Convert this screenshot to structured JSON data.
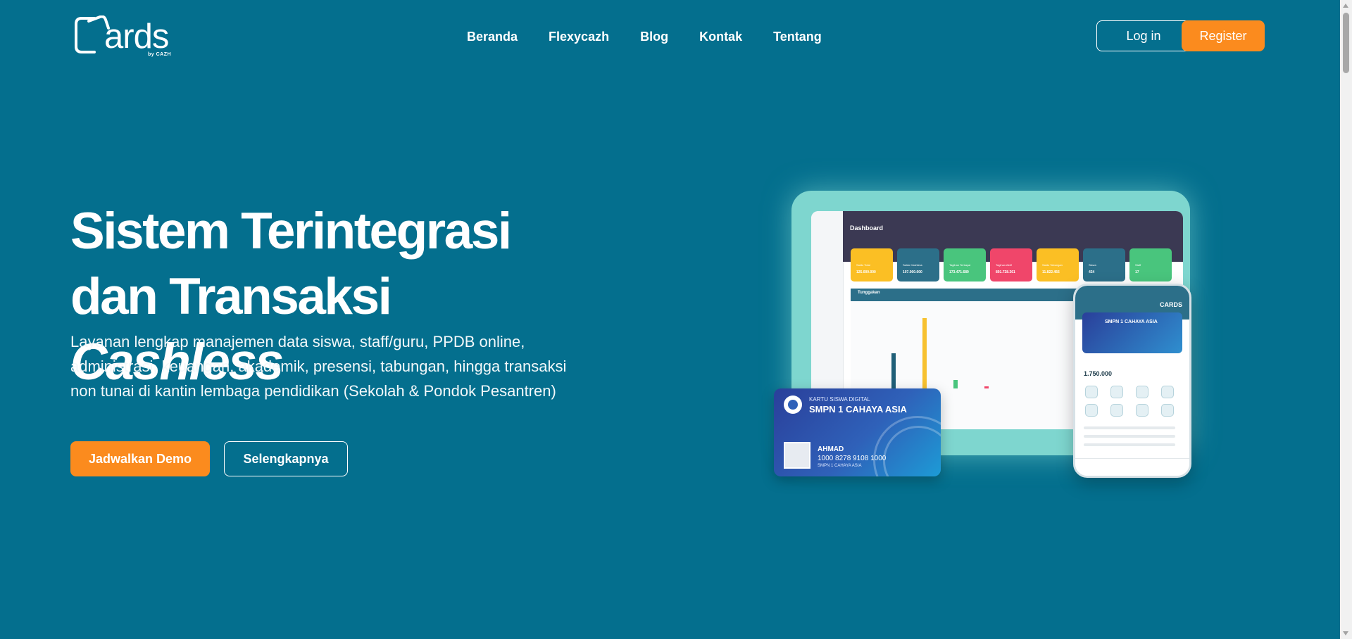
{
  "header": {
    "logo": {
      "word": "ards",
      "by": "by CAZH"
    },
    "nav": [
      "Beranda",
      "Flexycazh",
      "Blog",
      "Kontak",
      "Tentang"
    ],
    "login_label": "Log in",
    "register_label": "Register"
  },
  "hero": {
    "title_line1": "Sistem Terintegrasi",
    "title_line2_prefix": "dan Transaksi ",
    "title_line2_emphasis": "Cashless",
    "description": "Layanan lengkap manajemen data siswa, staff/guru, PPDB online, administrasi, keuangan, akademik, presensi, tabungan, hingga transaksi non tunai di kantin lembaga pendidikan (Sekolah & Pondok Pesantren)",
    "demo_label": "Jadwalkan Demo",
    "more_label": "Selengkapnya"
  },
  "illustration": {
    "dashboard_title": "Dashboard",
    "panel_title": "Tunggakan",
    "stat_cards": [
      {
        "color": "#fbbf24",
        "label": "Saldo Total",
        "value": "125.000.000"
      },
      {
        "color": "#2c6f89",
        "label": "Saldo Cashless",
        "value": "107.000.000"
      },
      {
        "color": "#49c57d",
        "label": "Tagihan Terbayar",
        "value": "173.471.689"
      },
      {
        "color": "#f0466a",
        "label": "Tagihan Aktif",
        "value": "891.728.361"
      },
      {
        "color": "#fbbf24",
        "label": "Saldo Tabungan",
        "value": "11.822.456"
      },
      {
        "color": "#2c6f89",
        "label": "Siswa",
        "value": "434"
      },
      {
        "color": "#49c57d",
        "label": "Staff",
        "value": "17"
      }
    ],
    "id_card": {
      "kicker": "KARTU SISWA DIGITAL",
      "school": "SMPN 1 CAHAYA ASIA",
      "name": "AHMAD",
      "number": "1000 8278 9108 1000",
      "school_small": "SMPN 1 CAHAYA ASIA"
    },
    "phone": {
      "brand": "CARDS",
      "card_school": "SMPN 1 CAHAYA ASIA",
      "balance": "1.750.000"
    }
  },
  "colors": {
    "background": "#046f8e",
    "accent": "#fb8b1e",
    "white": "#ffffff"
  }
}
